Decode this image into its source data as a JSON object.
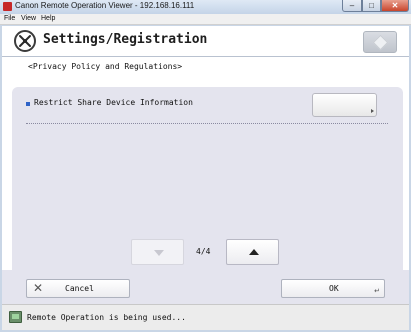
{
  "window": {
    "title": "Canon Remote Operation Viewer - 192.168.16.111",
    "minimize_glyph": "–",
    "maximize_glyph": "□",
    "close_glyph": "✕"
  },
  "menu": [
    "File",
    "View",
    "Help"
  ],
  "header": {
    "title": "Settings/Registration",
    "icon": "settings-wrench-icon"
  },
  "section": {
    "title": "<Privacy Policy and Regulations>"
  },
  "settings": [
    {
      "label": "Restrict Share Device Information",
      "value": ""
    }
  ],
  "pager": {
    "indicator": "4/4"
  },
  "footer": {
    "cancel_label": "Cancel",
    "ok_label": "OK"
  },
  "status": {
    "text": "Remote Operation is being used..."
  },
  "colors": {
    "accent": "#2e63c7",
    "panel": "#e4e4ee"
  }
}
